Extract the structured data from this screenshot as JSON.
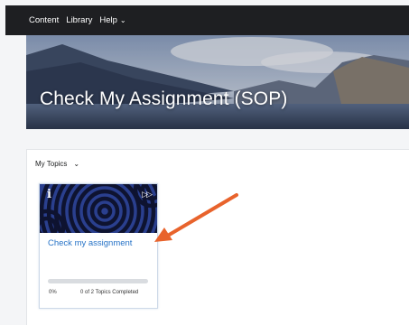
{
  "nav": {
    "items": [
      {
        "label": "Content",
        "has_dropdown": false
      },
      {
        "label": "Library",
        "has_dropdown": false
      },
      {
        "label": "Help",
        "has_dropdown": true
      }
    ],
    "chevron": "⌄"
  },
  "hero": {
    "title": "Check My Assignment (SOP)"
  },
  "topics": {
    "header_label": "My Topics",
    "chevron": "⌄",
    "card": {
      "info_glyph": "i",
      "nav_glyph": "▷▷",
      "title": "Check my assignment",
      "progress_percent": "0%",
      "progress_value": 0,
      "progress_text": "0 of 2 Topics Completed"
    }
  },
  "colors": {
    "nav_bg": "#1e1f22",
    "link": "#2773c7",
    "card_pattern": "#2a3f8e",
    "annotation_arrow": "#e8632c"
  },
  "icons": {
    "info": "info-icon",
    "forward": "fast-forward-icon",
    "annotation": "arrow-annotation-icon"
  }
}
